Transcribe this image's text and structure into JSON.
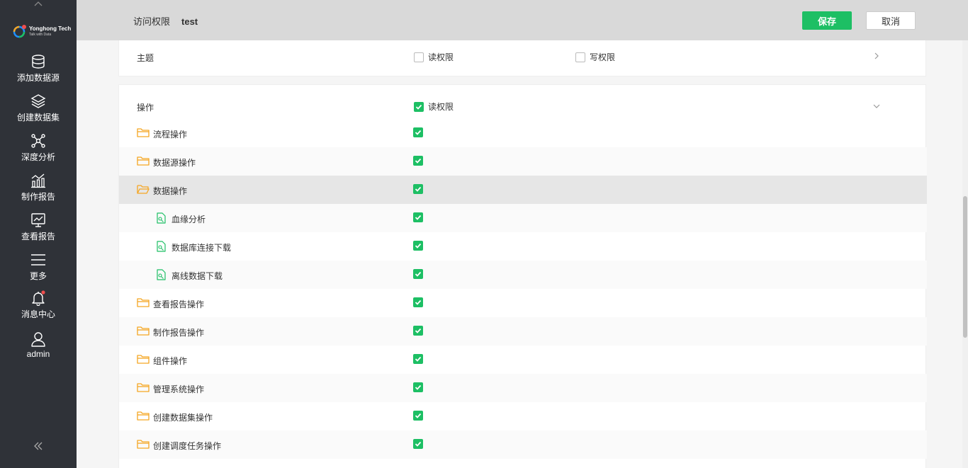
{
  "sidebar": {
    "logo": {
      "name": "Yonghong Tech",
      "tagline": "Talk with Data"
    },
    "items": [
      {
        "label": "添加数据源",
        "icon": "database-icon"
      },
      {
        "label": "创建数据集",
        "icon": "layers-icon"
      },
      {
        "label": "深度分析",
        "icon": "network-icon"
      },
      {
        "label": "制作报告",
        "icon": "chart-icon"
      },
      {
        "label": "查看报告",
        "icon": "monitor-icon"
      },
      {
        "label": "更多",
        "icon": "menu-icon"
      },
      {
        "label": "消息中心",
        "icon": "bell-icon"
      },
      {
        "label": "admin",
        "icon": "user-icon"
      }
    ]
  },
  "header": {
    "title": "访问权限",
    "subtitle": "test",
    "save_label": "保存",
    "cancel_label": "取消"
  },
  "theme_section": {
    "label": "主题",
    "read_label": "读权限",
    "write_label": "写权限",
    "read_checked": false,
    "write_checked": false
  },
  "ops_section": {
    "label": "操作",
    "read_label": "读权限",
    "read_checked": true,
    "rows": [
      {
        "label": "流程操作",
        "type": "folder",
        "checked": true
      },
      {
        "label": "数据源操作",
        "type": "folder",
        "checked": true
      },
      {
        "label": "数据操作",
        "type": "folder-open",
        "checked": true
      },
      {
        "label": "血缘分析",
        "type": "file",
        "checked": true
      },
      {
        "label": "数据库连接下载",
        "type": "file",
        "checked": true
      },
      {
        "label": "离线数据下载",
        "type": "file",
        "checked": true
      },
      {
        "label": "查看报告操作",
        "type": "folder",
        "checked": true
      },
      {
        "label": "制作报告操作",
        "type": "folder",
        "checked": true
      },
      {
        "label": "组件操作",
        "type": "folder",
        "checked": true
      },
      {
        "label": "管理系统操作",
        "type": "folder",
        "checked": true
      },
      {
        "label": "创建数据集操作",
        "type": "folder",
        "checked": true
      },
      {
        "label": "创建调度任务操作",
        "type": "folder",
        "checked": true
      }
    ]
  },
  "colors": {
    "accent": "#1dbf64",
    "folder": "#f5a623",
    "sidebar_bg": "#2f3238",
    "notify_dot": "#f04e4e"
  }
}
